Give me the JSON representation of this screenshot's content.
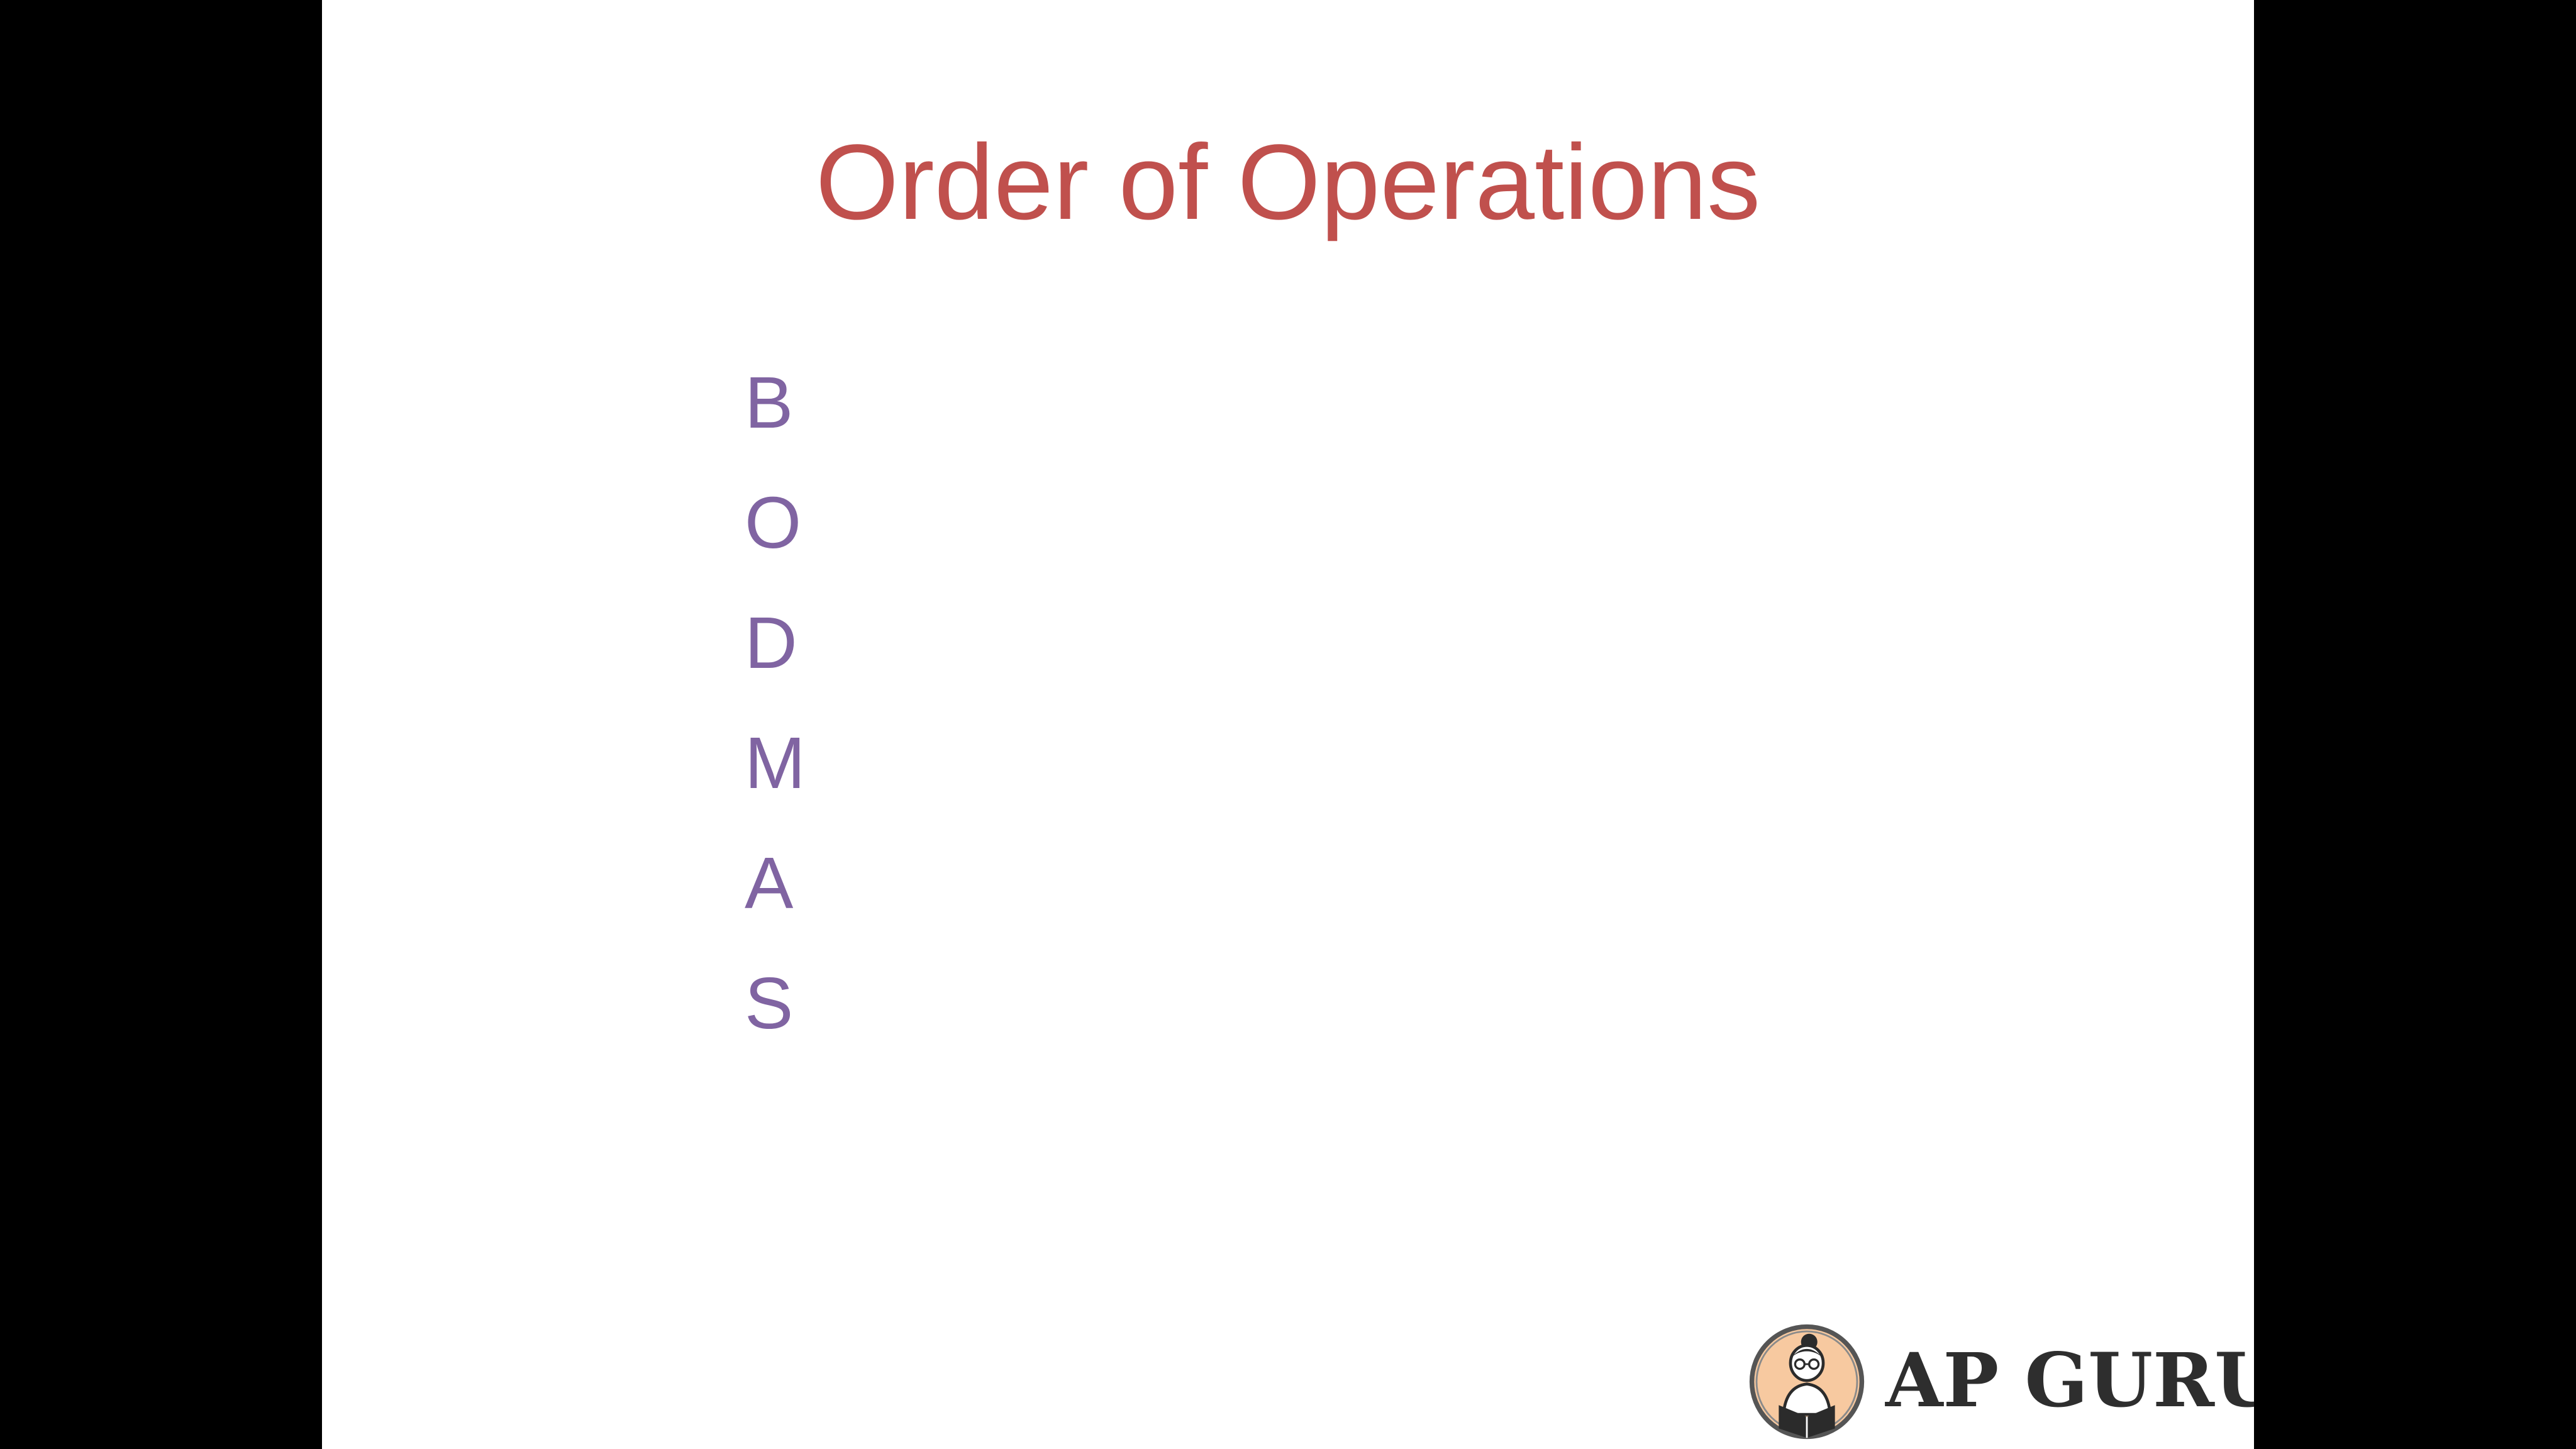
{
  "slide": {
    "title": "Order of Operations",
    "letters": [
      "B",
      "O",
      "D",
      "M",
      "A",
      "S"
    ]
  },
  "logo": {
    "text": "AP GURU"
  },
  "colors": {
    "title": "#c0504d",
    "letters": "#8064a2",
    "letterbox": "#000000",
    "logo_text": "#2e2e2e",
    "logo_badge": "#f7c9a0"
  },
  "icons": {
    "logo_badge": "guru-reading-avatar-icon"
  }
}
